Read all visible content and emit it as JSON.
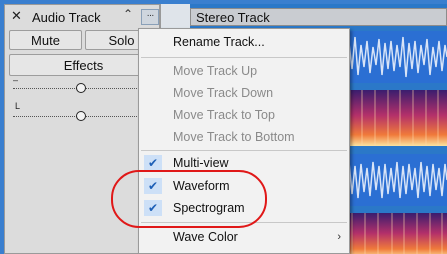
{
  "track_panel": {
    "close_icon": "close-icon",
    "track_name": "Audio Track",
    "collapse_icon": "chevron-up-icon",
    "menu_button": "···",
    "mute_label": "Mute",
    "solo_label": "Solo",
    "effects_label": "Effects",
    "gain_label": "–",
    "pan_label": "L"
  },
  "clip": {
    "name": "Stereo Track"
  },
  "context_menu": {
    "items": [
      {
        "label": "Rename Track...",
        "enabled": true,
        "checked": false
      },
      {
        "label": "Move Track Up",
        "enabled": false,
        "checked": false
      },
      {
        "label": "Move Track Down",
        "enabled": false,
        "checked": false
      },
      {
        "label": "Move Track to Top",
        "enabled": false,
        "checked": false
      },
      {
        "label": "Move Track to Bottom",
        "enabled": false,
        "checked": false
      },
      {
        "label": "Multi-view",
        "enabled": true,
        "checked": true
      },
      {
        "label": "Waveform",
        "enabled": true,
        "checked": true
      },
      {
        "label": "Spectrogram",
        "enabled": true,
        "checked": true
      },
      {
        "label": "Wave Color",
        "enabled": true,
        "checked": false,
        "submenu": true
      }
    ],
    "check_glyph": "✔",
    "submenu_glyph": "›"
  },
  "colors": {
    "accent_blue": "#2b78c8",
    "waveform_blue": "#2b6fd3",
    "annotation_red": "#e01818"
  }
}
